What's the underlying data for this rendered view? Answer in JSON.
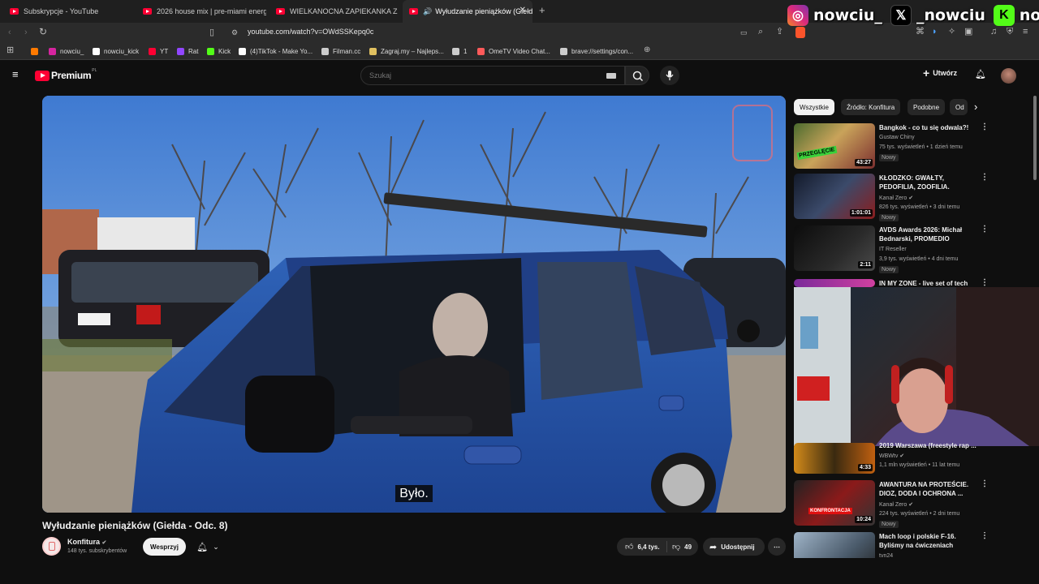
{
  "browser": {
    "tabs": [
      {
        "title": "Subskrypcje - YouTube"
      },
      {
        "title": "2026 house mix | pre-miami energy"
      },
      {
        "title": "WIELKANOCNA ZAPIEKANKA Z BIAŁ"
      },
      {
        "title": "Wyłudzanie pieniążków (Giełd"
      }
    ],
    "new_tab_glyph": "+",
    "url": "youtube.com/watch?v=OWdSSKepq0c",
    "bookmarks": [
      {
        "label": "nowciu_",
        "icon": "instagram-icon",
        "color": "#d6249f"
      },
      {
        "label": "nowciu_kick",
        "icon": "x-icon",
        "color": "#ffffff"
      },
      {
        "label": "YT",
        "icon": "youtube-icon",
        "color": "#ff0033"
      },
      {
        "label": "Rat",
        "icon": "twitch-icon",
        "color": "#9146ff"
      },
      {
        "label": "Kick",
        "icon": "kick-icon",
        "color": "#53fc18"
      },
      {
        "label": "(4)TikTok - Make Yo...",
        "icon": "tiktok-icon",
        "color": "#ffffff"
      },
      {
        "label": "Filman.cc",
        "icon": "filman-icon",
        "color": "#cccccc"
      },
      {
        "label": "Zagraj.my – Najleps...",
        "icon": "zagraj-icon",
        "color": "#e0c060"
      },
      {
        "label": "1",
        "icon": "globe-icon",
        "color": "#cccccc"
      },
      {
        "label": "OmeTV Video Chat...",
        "icon": "ometv-icon",
        "color": "#ff5a5a"
      },
      {
        "label": "brave://settings/con...",
        "icon": "globe-icon",
        "color": "#cccccc"
      }
    ]
  },
  "overlay": {
    "socials": [
      {
        "icon": "instagram-icon",
        "handle": "nowciu_"
      },
      {
        "icon": "x-icon",
        "handle": "_nowciu"
      },
      {
        "icon": "kick-icon",
        "handle": "nowciu"
      }
    ]
  },
  "youtube": {
    "logo_text": "Premium",
    "logo_region": "PL",
    "search_placeholder": "Szukaj",
    "create_label": "Utwórz",
    "video": {
      "subtitle": "Było.",
      "title": "Wyłudzanie pieniążków (Giełda - Odc. 8)",
      "channel": "Konfitura",
      "subscribers": "148 tys. subskrybentów",
      "support_label": "Wesprzyj",
      "likes": "6,4 tys.",
      "dislikes": "49",
      "share_label": "Udostępnij"
    },
    "chips": [
      "Wszystkie",
      "Źródło: Konfitura",
      "Podobne",
      "Od"
    ],
    "recommendations": [
      {
        "title": "Bangkok - co tu się odwala?!",
        "channel": "Gustaw Chiny",
        "meta": "75 tys. wyświetleń • 1 dzień temu",
        "badge": "Nowy",
        "duration": "43:27"
      },
      {
        "title": "KŁODZKO: GWAŁTY, PEDOFILIA, ZOOFILIA. WSTRZĄSAJĄCE ...",
        "channel": "Kanał Zero",
        "meta": "826 tys. wyświetleń • 3 dni temu",
        "badge": "Nowy",
        "duration": "1:01:01"
      },
      {
        "title": "AVDS Awards 2026: Michał Bednarski, PROMEDIO",
        "channel": "IT Reseller",
        "meta": "3,9 tys. wyświetleń • 4 dni temu",
        "badge": "Nowy",
        "duration": "2:11"
      },
      {
        "title": "IN MY ZONE - live set of tech",
        "channel": "",
        "meta": "",
        "badge": "",
        "duration": ""
      },
      {
        "title": "2019 Warszawa (freestyle rap ...",
        "channel": "WBWtv",
        "meta": "1,1 mln wyświetleń • 11 lat temu",
        "badge": "",
        "duration": "4:33"
      },
      {
        "title": "AWANTURA NA PROTEŚCIE. DIOZ, DODA I OCHRONA ...",
        "channel": "Kanał Zero",
        "meta": "224 tys. wyświetleń • 2 dni temu",
        "badge": "Nowy",
        "duration": "10:24"
      },
      {
        "title": "Mach loop i polskie F-16. Byliśmy na ćwiczeniach Cobra...",
        "channel": "tvn24",
        "meta": "",
        "badge": "",
        "duration": ""
      }
    ]
  },
  "colors": {
    "yt_red": "#ff0033",
    "bg": "#0f0f0f",
    "kick_green": "#53fc18"
  }
}
